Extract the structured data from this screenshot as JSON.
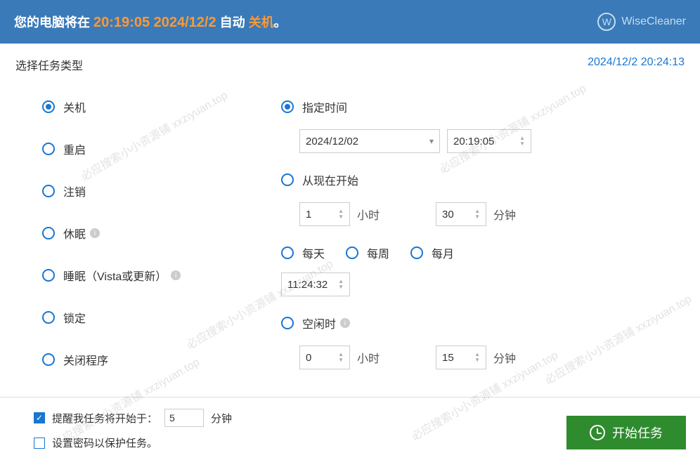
{
  "header": {
    "prefix": "您的电脑将在 ",
    "time": "20:19:05 2024/12/2",
    "middle": " 自动 ",
    "action": "关机",
    "suffix": "。",
    "brand": "WiseCleaner",
    "brand_letter": "W"
  },
  "subheader": {
    "title": "选择任务类型",
    "clock": "2024/12/2 20:24:13"
  },
  "tasks": {
    "shutdown": "关机",
    "restart": "重启",
    "logoff": "注销",
    "hibernate": "休眠",
    "sleep": "睡眠（Vista或更新）",
    "lock": "锁定",
    "close_app": "关闭程序"
  },
  "schedule": {
    "specified": "指定时间",
    "date_value": "2024/12/02",
    "time_value": "20:19:05",
    "from_now": "从现在开始",
    "from_hours": "1",
    "from_minutes": "30",
    "unit_hour": "小时",
    "unit_minute": "分钟",
    "daily": "每天",
    "weekly": "每周",
    "monthly": "每月",
    "daily_time": "11:24:32",
    "idle": "空闲时",
    "idle_hours": "0",
    "idle_minutes": "15"
  },
  "footer": {
    "remind_label_a": "提醒我任务将开始于：",
    "remind_value": "5",
    "remind_label_b": "分钟",
    "password_label": "设置密码以保护任务。",
    "start_button": "开始任务"
  },
  "watermark": "必应搜索小小资源铺  xxziyuan.top"
}
